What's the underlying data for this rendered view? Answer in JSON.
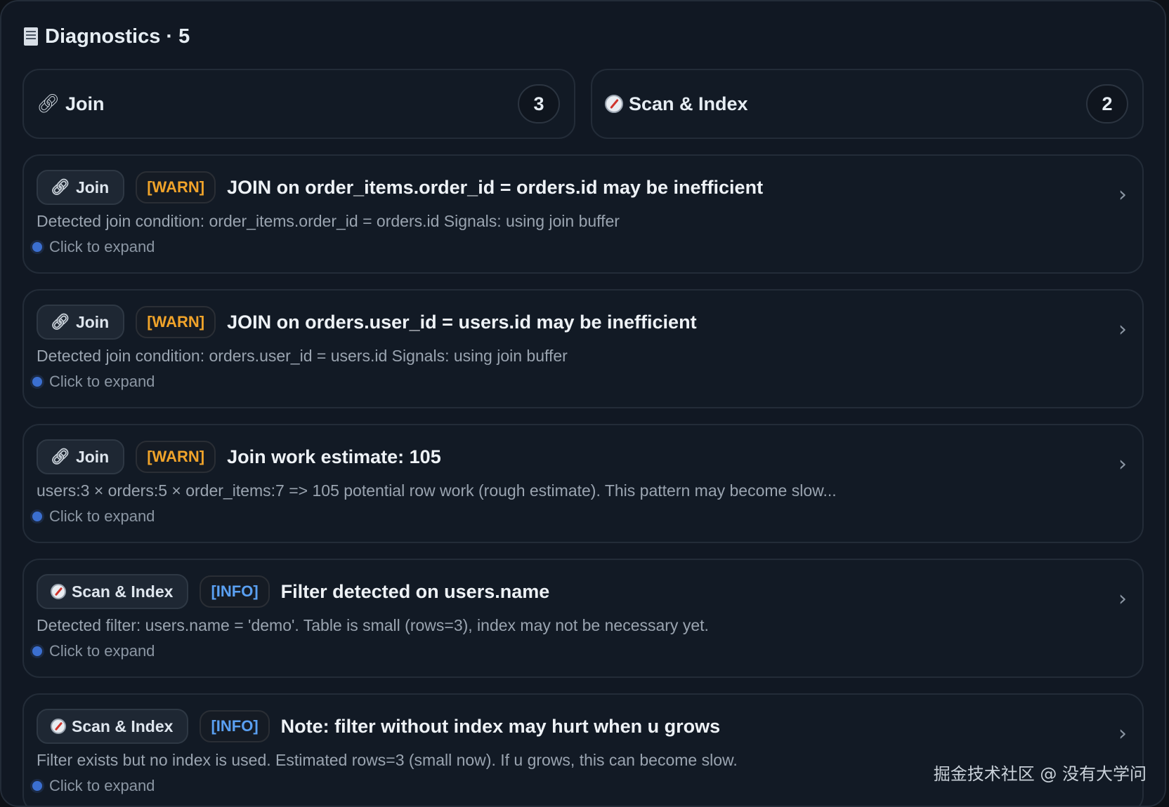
{
  "header": {
    "icon": "document-icon",
    "title": "Diagnostics · 5"
  },
  "groups": [
    {
      "icon": "link-icon",
      "label": "Join",
      "count": "3"
    },
    {
      "icon": "compass-icon",
      "label": "Scan & Index",
      "count": "2"
    }
  ],
  "items": [
    {
      "category": "Join",
      "category_icon": "link-icon",
      "severity": "[WARN]",
      "title": "JOIN on order_items.order_id = orders.id may be inefficient",
      "description": "Detected join condition: order_items.order_id = orders.id Signals: using join buffer",
      "expand_label": "Click to expand"
    },
    {
      "category": "Join",
      "category_icon": "link-icon",
      "severity": "[WARN]",
      "title": "JOIN on orders.user_id = users.id may be inefficient",
      "description": "Detected join condition: orders.user_id = users.id Signals: using join buffer",
      "expand_label": "Click to expand"
    },
    {
      "category": "Join",
      "category_icon": "link-icon",
      "severity": "[WARN]",
      "title": "Join work estimate: 105",
      "description": "users:3 × orders:5 × order_items:7 => 105 potential row work (rough estimate). This pattern may become slow...",
      "expand_label": "Click to expand"
    },
    {
      "category": "Scan & Index",
      "category_icon": "compass-icon",
      "severity": "[INFO]",
      "title": "Filter detected on users.name",
      "description": "Detected filter: users.name = 'demo'. Table is small (rows=3), index may not be necessary yet.",
      "expand_label": "Click to expand"
    },
    {
      "category": "Scan & Index",
      "category_icon": "compass-icon",
      "severity": "[INFO]",
      "title": "Note: filter without index may hurt when u grows",
      "description": "Filter exists but no index is used. Estimated rows=3 (small now). If u grows, this can become slow.",
      "expand_label": "Click to expand"
    }
  ],
  "watermark": "掘金技术社区 @ 没有大学问",
  "colors": {
    "background": "#111823",
    "warn": "#f0a32a",
    "info": "#5aa0f2",
    "expand_dot": "#3b6fd0"
  }
}
